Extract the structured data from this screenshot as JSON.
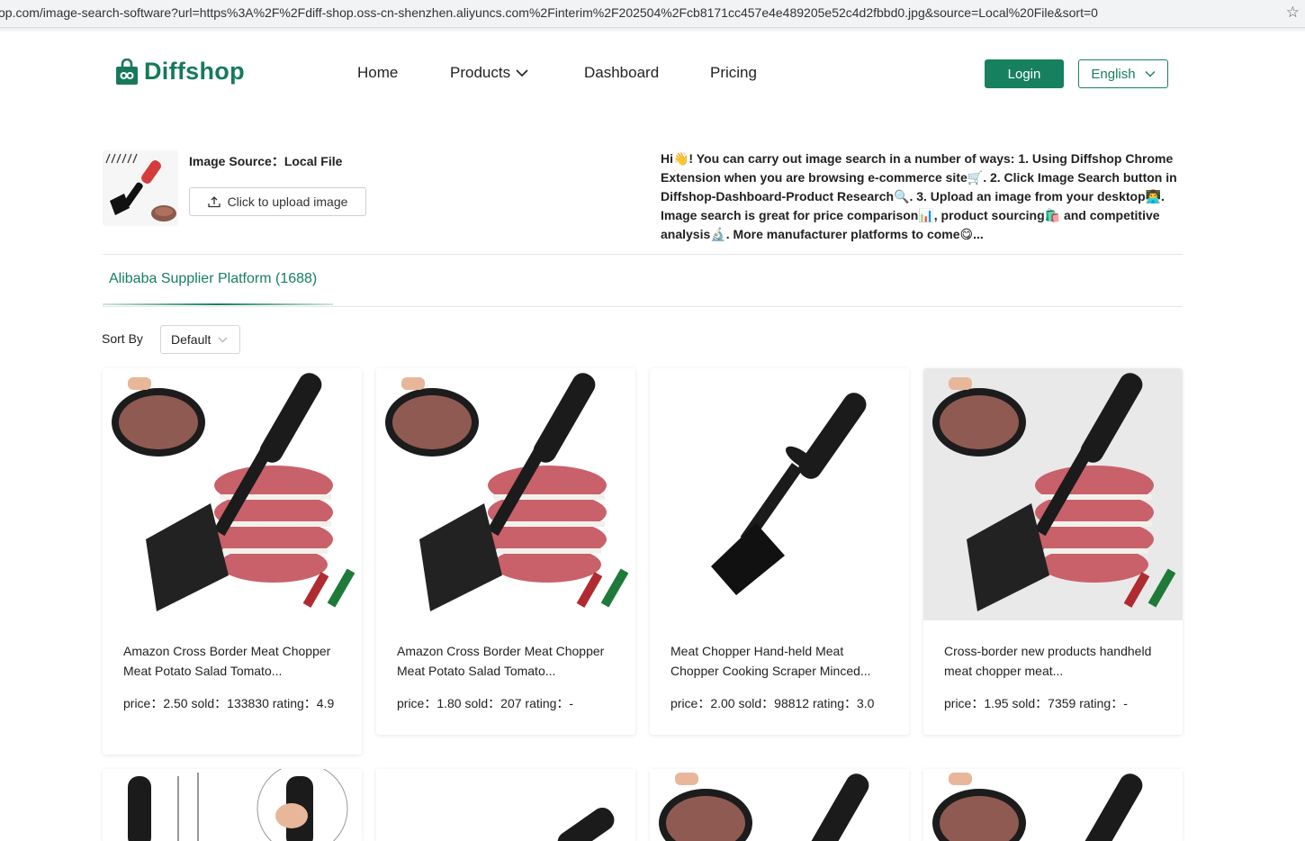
{
  "browser": {
    "url": "op.com/image-search-software?url=https%3A%2F%2Fdiff-shop.oss-cn-shenzhen.aliyuncs.com%2Finterim%2F202504%2Fcb8171cc457e4e489205e52c4d2fbbd0.jpg&source=Local%20File&sort=0",
    "bookmark_icon": "star-icon"
  },
  "header": {
    "logo_text": "Diffshop",
    "nav": {
      "home": "Home",
      "products": "Products",
      "dashboard": "Dashboard",
      "pricing": "Pricing"
    },
    "login_label": "Login",
    "language_label": "English",
    "brand_color": "#17805f"
  },
  "source": {
    "label": "Image Source：Local File",
    "upload_label": "Click to upload image",
    "help_text": "Hi👋! You can carry out image search in a number of ways: 1. Using Diffshop Chrome Extension when you are browsing e-commerce site🛒. 2. Click Image Search button in Diffshop-Dashboard-Product Research🔍. 3. Upload an image from your desktop👨‍💻. Image search is great for price comparison📊, product sourcing🛍️ and competitive analysis🔬. More manufacturer platforms to come😋..."
  },
  "tabs": [
    {
      "label": "Alibaba Supplier Platform (1688)",
      "active": true
    }
  ],
  "sort": {
    "label": "Sort By",
    "value": "Default"
  },
  "products": [
    {
      "title": "Amazon Cross Border Meat Chopper Meat Potato Salad Tomato...",
      "stats": "price：2.50 sold：133830 rating：4.9"
    },
    {
      "title": "Amazon Cross Border Meat Chopper Meat Potato Salad Tomato...",
      "stats": "price：1.80 sold：207 rating：-"
    },
    {
      "title": "Meat Chopper Hand-held Meat Chopper Cooking Scraper Minced...",
      "stats": "price：2.00 sold：98812 rating：3.0"
    },
    {
      "title": "Cross-border new products handheld meat chopper meat...",
      "stats": "price：1.95 sold：7359 rating：-"
    }
  ]
}
